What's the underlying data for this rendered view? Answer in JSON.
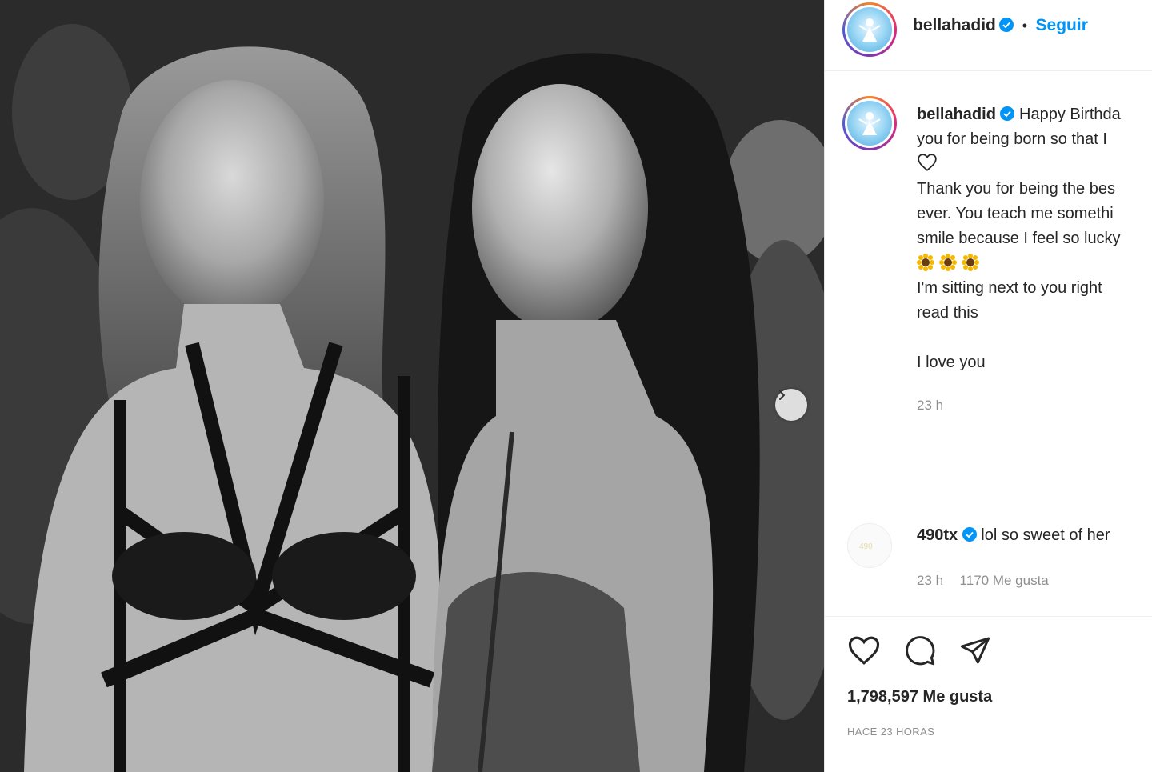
{
  "post": {
    "username": "bellahadid",
    "follow_separator": "•",
    "follow_label": "Seguir"
  },
  "caption": {
    "username": "bellahadid",
    "line1": "Happy Birthda",
    "line2": "you for being born so that I",
    "line4": "Thank you for being the bes",
    "line5": "ever. You teach me somethi",
    "line6": "smile because I feel so lucky",
    "line8": "I'm sitting next to you right",
    "line9": "read this",
    "line11": "I love you",
    "timestamp": "23 h",
    "emoji_icons": [
      "sunflower-icon",
      "sunflower-icon",
      "sunflower-icon"
    ]
  },
  "comment": {
    "username": "490tx",
    "text": "lol so sweet of her",
    "timestamp": "23 h",
    "likes": "1170 Me gusta"
  },
  "actions": {
    "likes": "1,798,597 Me gusta",
    "time_ago": "HACE 23 HORAS"
  },
  "colors": {
    "accent": "#0095f6",
    "text": "#262626",
    "muted": "#8e8e8e"
  }
}
